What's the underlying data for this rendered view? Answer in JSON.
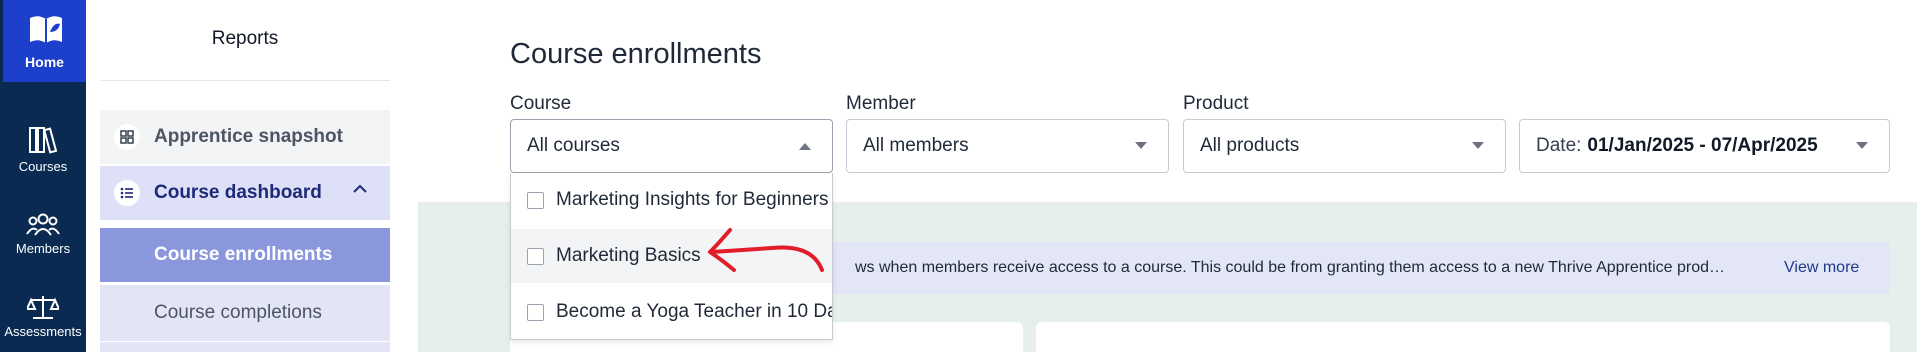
{
  "rail": {
    "home_label": "Home",
    "courses_label": "Courses",
    "members_label": "Members",
    "assessments_label": "Assessments"
  },
  "sidebar": {
    "title": "Reports",
    "items": [
      {
        "label": "Apprentice snapshot",
        "icon": "grid-icon"
      },
      {
        "label": "Course dashboard",
        "icon": "list-icon",
        "expanded": true
      },
      {
        "label": "Course enrollments",
        "active": true
      },
      {
        "label": "Course completions"
      }
    ]
  },
  "main": {
    "title": "Course enrollments",
    "filters": {
      "course_label": "Course",
      "course_value": "All courses",
      "member_label": "Member",
      "member_value": "All members",
      "product_label": "Product",
      "product_value": "All products",
      "date_prefix": "Date:",
      "date_value": "01/Jan/2025 - 07/Apr/2025"
    },
    "course_options": [
      "Marketing Insights for Beginners",
      "Marketing Basics",
      "Become a Yoga Teacher in 10 Da"
    ],
    "info_text": "ws when members receive access to a course. This could be from granting them access to a new Thrive Apprentice prod…",
    "view_more": "View more"
  },
  "colors": {
    "rail_bg": "#0b2a52",
    "home_bg": "#1c3fcc",
    "active_item": "#8b97dd",
    "annotation_arrow": "#e11d2a"
  }
}
